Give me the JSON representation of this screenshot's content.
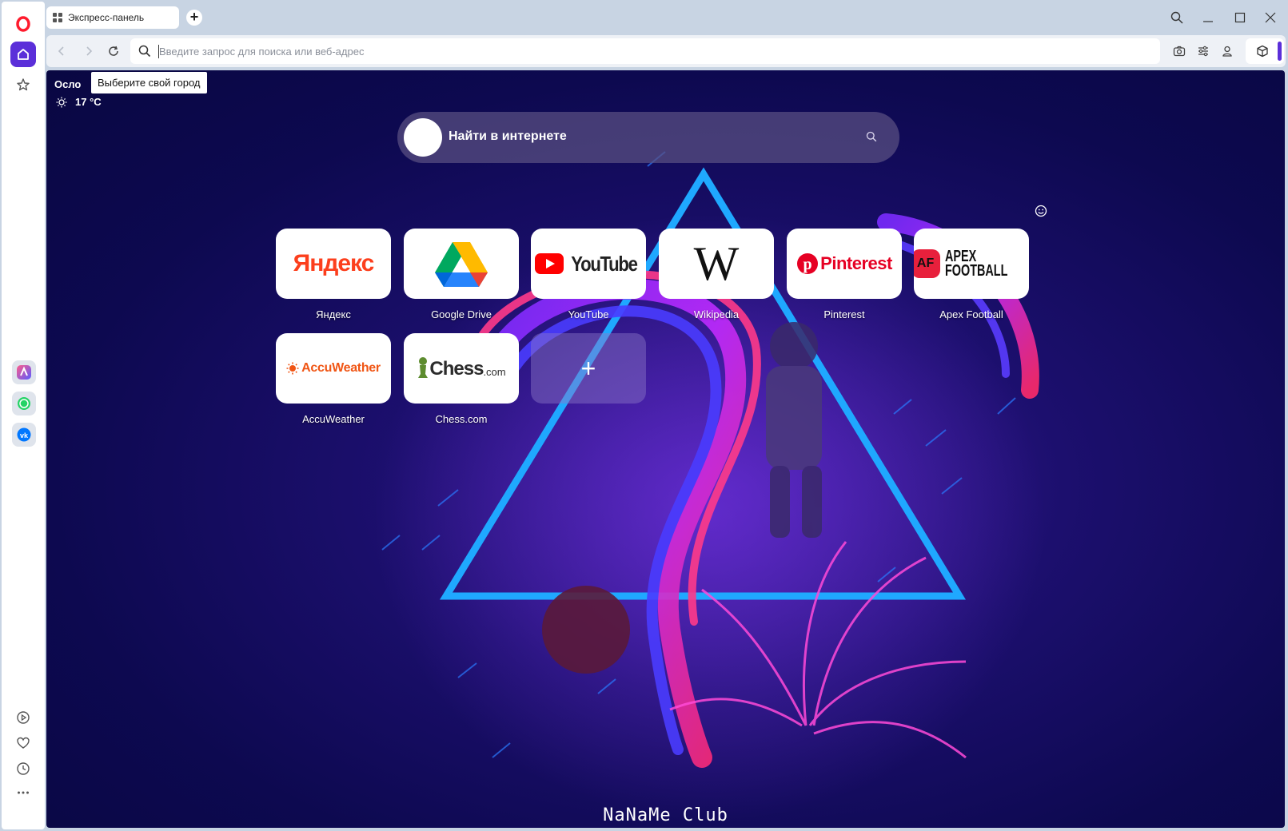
{
  "browser": {
    "tab_title": "Экспресс-панель",
    "address_placeholder": "Введите запрос для поиска или веб-адрес"
  },
  "weather": {
    "city": "Осло",
    "tooltip": "Выберите свой город",
    "temperature": "17 °C"
  },
  "search": {
    "placeholder": "Найти в интернете"
  },
  "speed_dial": [
    {
      "label": "Яндекс",
      "logo_text": "Яндекс"
    },
    {
      "label": "Google Drive",
      "logo_text": ""
    },
    {
      "label": "YouTube",
      "logo_text": "YouTube"
    },
    {
      "label": "Wikipedia",
      "logo_text": "W"
    },
    {
      "label": "Pinterest",
      "logo_text": "Pinterest"
    },
    {
      "label": "Apex Football",
      "logo_text_1": "APEX",
      "logo_text_2": "FOOTBALL",
      "logo_badge": "AF"
    },
    {
      "label": "AccuWeather",
      "logo_text": "AccuWeather"
    },
    {
      "label": "Chess.com",
      "logo_text": "Chess",
      "logo_suffix": ".com"
    },
    {
      "label": "",
      "logo_text": "+"
    }
  ],
  "wallpaper_caption": "NaNaMe Club",
  "colors": {
    "accent": "#5b2fd9",
    "opera_red": "#ff1b2d",
    "youtube_red": "#ff0000",
    "pinterest_red": "#e60023",
    "accuweather_orange": "#f05514",
    "chess_green": "#5d8c2f"
  },
  "icons": [
    "opera-logo-icon",
    "home-icon",
    "star-icon",
    "aria-icon",
    "whatsapp-icon",
    "vk-icon",
    "player-icon",
    "heart-icon",
    "history-icon",
    "more-icon",
    "search-icon",
    "camera-icon",
    "easy-setup-icon",
    "profile-icon",
    "cube-icon",
    "minimize-icon",
    "maximize-icon",
    "close-icon",
    "sun-icon",
    "smiley-icon"
  ]
}
